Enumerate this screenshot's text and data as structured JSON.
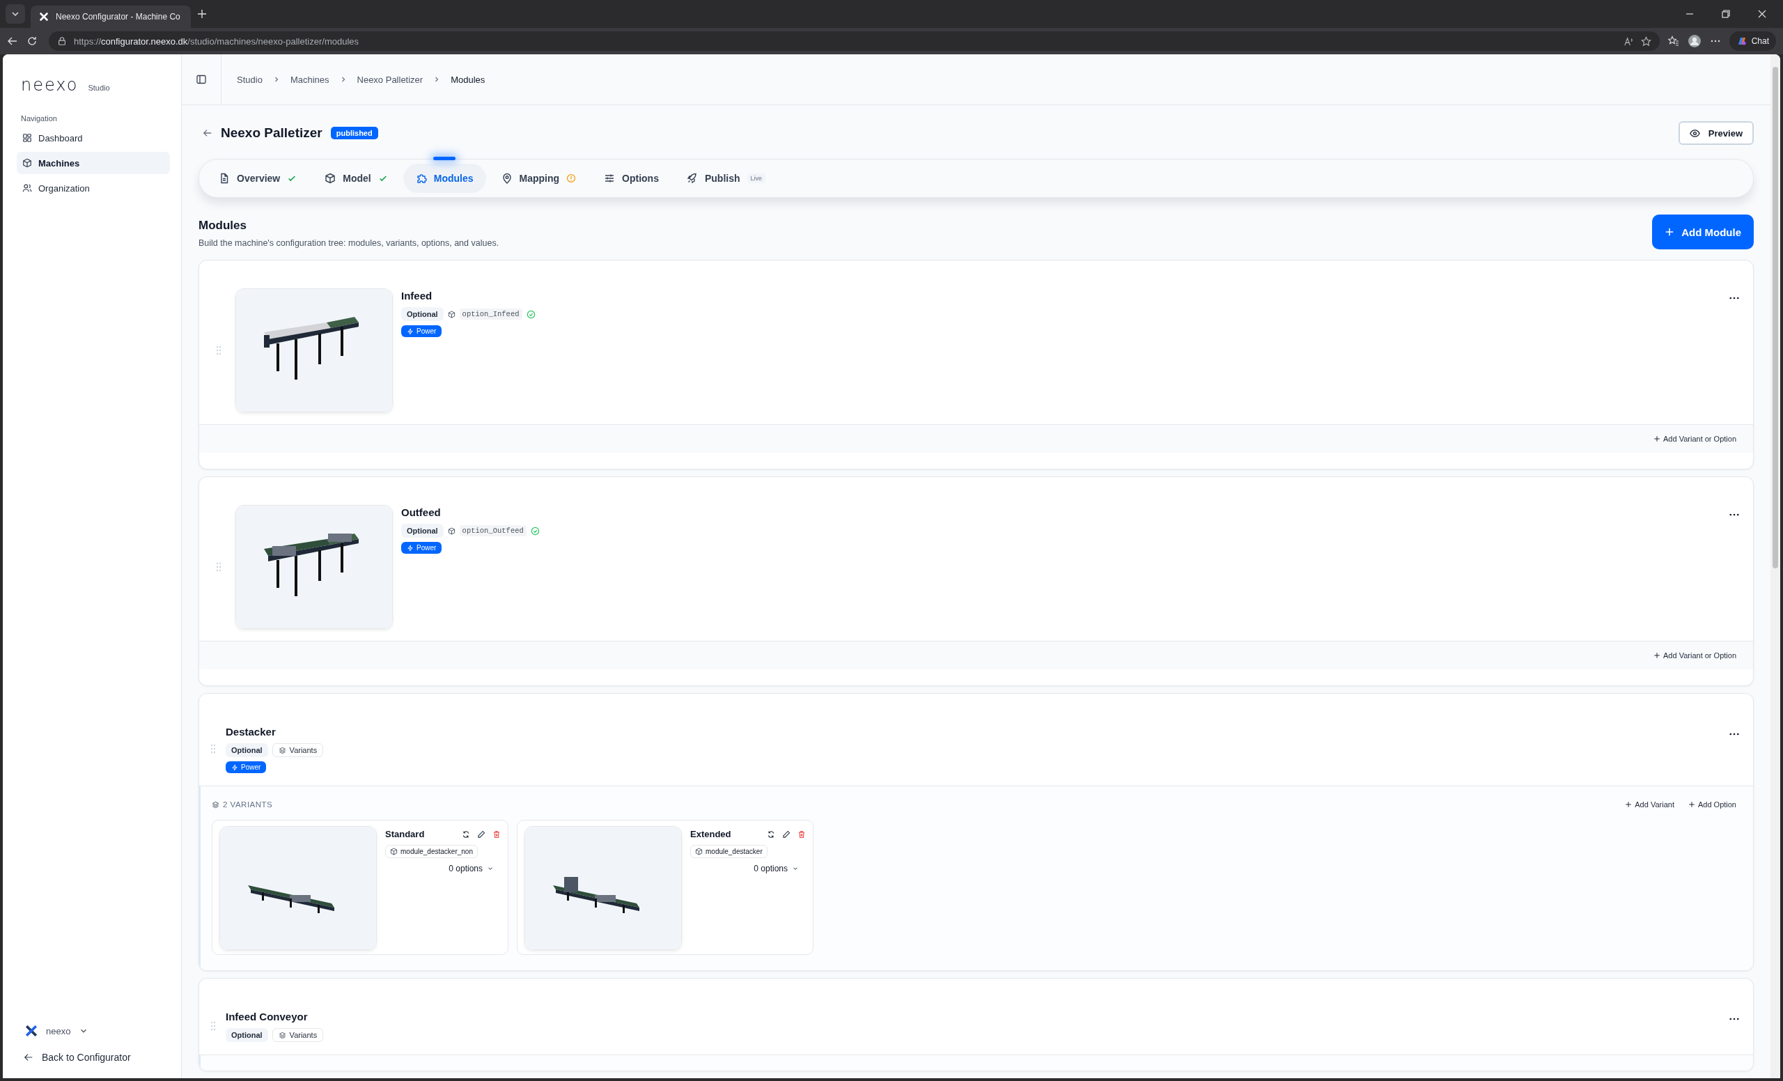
{
  "browser": {
    "url_scheme": "https://",
    "tab_title": "Neexo Configurator - Machine Co",
    "url_host": "configurator.neexo.dk",
    "url_path": "/studio/machines/neexo-palletizer/modules",
    "chat_label": "Chat"
  },
  "sidebar": {
    "brand": "neexo",
    "brand_sub": "Studio",
    "section_label": "Navigation",
    "items": [
      {
        "label": "Dashboard",
        "selected": false
      },
      {
        "label": "Machines",
        "selected": true
      },
      {
        "label": "Organization",
        "selected": false
      }
    ],
    "workspace": "neexo",
    "back_link": "Back to Configurator"
  },
  "breadcrumb": [
    "Studio",
    "Machines",
    "Neexo Palletizer",
    "Modules"
  ],
  "header": {
    "title": "Neexo Palletizer",
    "status": "published",
    "preview_button": "Preview"
  },
  "tabs": [
    {
      "label": "Overview",
      "complete": true,
      "warning": false,
      "selected": false
    },
    {
      "label": "Model",
      "complete": true,
      "warning": false,
      "selected": false
    },
    {
      "label": "Modules",
      "complete": false,
      "warning": false,
      "selected": true
    },
    {
      "label": "Mapping",
      "complete": false,
      "warning": true,
      "selected": false
    },
    {
      "label": "Options",
      "complete": false,
      "warning": false,
      "selected": false
    },
    {
      "label": "Publish",
      "badge": "Live",
      "complete": false,
      "warning": false,
      "selected": false
    }
  ],
  "section": {
    "title": "Modules",
    "subtitle": "Build the machine's configuration tree: modules, variants, options, and values.",
    "add_button": "Add Module"
  },
  "modules": [
    {
      "kind": "single",
      "name": "Infeed",
      "optional_label": "Optional",
      "model_ref": "option_Infeed",
      "model_ok": true,
      "tag": "Power",
      "footer_action": "Add Variant or Option"
    },
    {
      "kind": "single",
      "name": "Outfeed",
      "optional_label": "Optional",
      "model_ref": "option_Outfeed",
      "model_ok": true,
      "tag": "Power",
      "footer_action": "Add Variant or Option"
    },
    {
      "kind": "variants",
      "name": "Destacker",
      "optional_label": "Optional",
      "variants_label": "Variants",
      "tag": "Power",
      "variants_heading": "2 VARIANTS",
      "actions": [
        "Add Variant",
        "Add Option"
      ],
      "variants": [
        {
          "name": "Standard",
          "model_ref": "module_destacker_non",
          "options": "0 options"
        },
        {
          "name": "Extended",
          "model_ref": "module_destacker",
          "options": "0 options"
        }
      ]
    },
    {
      "kind": "variants",
      "name": "Infeed Conveyor",
      "optional_label": "Optional",
      "variants_label": "Variants"
    }
  ]
}
